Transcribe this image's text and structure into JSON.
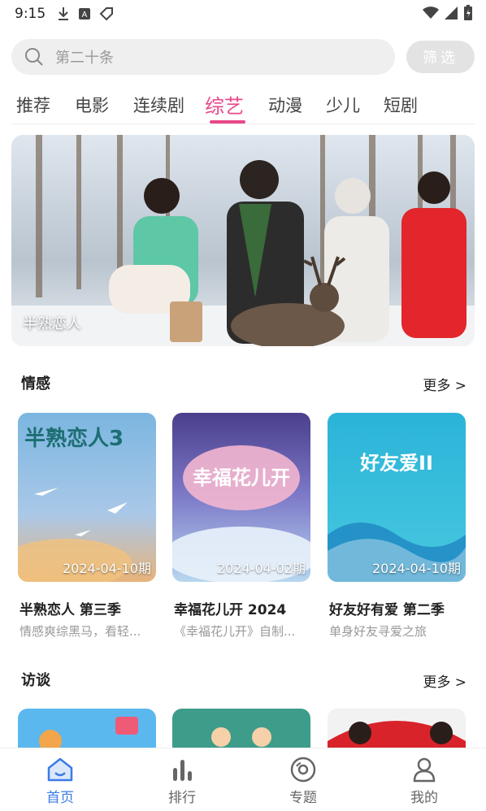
{
  "status_bar": {
    "time": "9:15",
    "left_icons": [
      "download-icon",
      "a-box-icon",
      "tag-icon"
    ],
    "right_icons": [
      "wifi-icon",
      "signal-icon",
      "battery-charging-icon"
    ]
  },
  "search": {
    "placeholder": "第二十条",
    "filter_label": "筛选"
  },
  "tabs": [
    {
      "label": "推荐",
      "active": false
    },
    {
      "label": "电影",
      "active": false
    },
    {
      "label": "连续剧",
      "active": false
    },
    {
      "label": "综艺",
      "active": true
    },
    {
      "label": "动漫",
      "active": false
    },
    {
      "label": "少儿",
      "active": false
    },
    {
      "label": "短剧",
      "active": false
    }
  ],
  "banner": {
    "caption": "半熟恋人"
  },
  "sections": [
    {
      "title": "情感",
      "more": "更多 >",
      "cards": [
        {
          "title": "半熟恋人 第三季",
          "desc": "情感爽综黑马，看轻...",
          "date": "2024-04-10期",
          "art_text": "半熟恋人3"
        },
        {
          "title": "幸福花儿开 2024",
          "desc": "《幸福花儿开》自制...",
          "date": "2024-04-02期",
          "art_text": "幸福花儿开"
        },
        {
          "title": "好友好有爱 第二季",
          "desc": "单身好友寻爱之旅",
          "date": "2024-04-10期",
          "art_text": "好友爱II"
        }
      ]
    },
    {
      "title": "访谈",
      "more": "更多 >",
      "cards": []
    }
  ],
  "bottom_nav": [
    {
      "label": "首页",
      "icon": "home-icon",
      "active": true
    },
    {
      "label": "排行",
      "icon": "bar-chart-icon",
      "active": false
    },
    {
      "label": "专题",
      "icon": "disc-icon",
      "active": false
    },
    {
      "label": "我的",
      "icon": "user-icon",
      "active": false
    }
  ],
  "colors": {
    "accent": "#e9488a",
    "nav_active": "#3b7be8"
  }
}
